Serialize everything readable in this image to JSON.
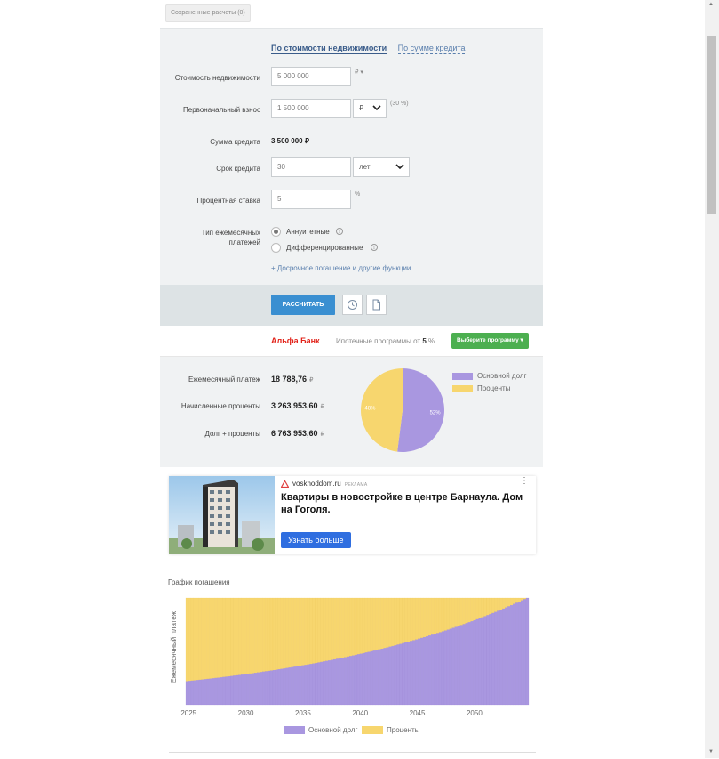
{
  "saved_button": "Сохраненные расчеты (0)",
  "tabs": [
    "По стоимости недвижимости",
    "По сумме кредита"
  ],
  "form": {
    "property_cost": {
      "label": "Стоимость недвижимости",
      "value": "5 000 000",
      "unit": "₽ ▾"
    },
    "down_payment": {
      "label": "Первоначальный взнос",
      "value": "1 500 000",
      "currency": "₽",
      "percent": "(30 %)"
    },
    "loan_amount": {
      "label": "Сумма кредита",
      "value": "3 500 000 ₽"
    },
    "term": {
      "label": "Срок кредита",
      "value": "30",
      "unit": "лет"
    },
    "rate": {
      "label": "Процентная ставка",
      "value": "5",
      "unit": "%"
    },
    "payment_type": {
      "label_line1": "Тип ежемесячных",
      "label_line2": "платежей",
      "options": [
        "Аннуитетные",
        "Дифференцированные"
      ],
      "selected": 0
    },
    "more_link": "+ Досрочное погашение и другие функции"
  },
  "actions": {
    "calculate": "РАССЧИТАТЬ",
    "history_icon": "clock-icon",
    "doc_icon": "document-icon"
  },
  "bank": {
    "name": "Альфа Банк",
    "text_prefix": "Ипотечные программы от",
    "rate": "5",
    "text_suffix": "%",
    "button": "Выберите программу ▾"
  },
  "results": {
    "monthly": {
      "label": "Ежемесячный платеж",
      "value": "18 788,76",
      "cur": "₽"
    },
    "interest": {
      "label": "Начисленные проценты",
      "value": "3 263 953,60",
      "cur": "₽"
    },
    "total": {
      "label": "Долг + проценты",
      "value": "6 763 953,60",
      "cur": "₽"
    }
  },
  "pie": {
    "slices": [
      {
        "name": "Основной долг",
        "percent": 52,
        "label": "52%",
        "color": "#a997e0"
      },
      {
        "name": "Проценты",
        "percent": 48,
        "label": "48%",
        "color": "#f7d66e"
      }
    ]
  },
  "ad": {
    "domain": "voskhoddom.ru",
    "tag": "РЕКЛАМА",
    "title": "Квартиры в новостройке в центре Барнаула. Дом на Гоголя.",
    "button": "Узнать больше"
  },
  "schedule": {
    "title": "График погашения",
    "ylabel": "Ежемесячный платеж",
    "x_ticks": [
      "2025",
      "2030",
      "2035",
      "2040",
      "2045",
      "2050"
    ],
    "legend": [
      "Основной долг",
      "Проценты"
    ]
  },
  "chart_data": {
    "type": "bar",
    "stacked": true,
    "x_range": [
      2024.75,
      2054.75
    ],
    "x_ticks": [
      "2025",
      "2030",
      "2035",
      "2040",
      "2045",
      "2050"
    ],
    "series": [
      {
        "name": "Основной долг",
        "color": "#a997e0",
        "start_share": 0.22,
        "end_share": 1.0,
        "growth": "exponential",
        "rate_annual": 5
      },
      {
        "name": "Проценты",
        "color": "#f7d66e",
        "start_share": 0.78,
        "end_share": 0.0
      }
    ],
    "monthly_payment": 18788.76,
    "periods": 360
  }
}
